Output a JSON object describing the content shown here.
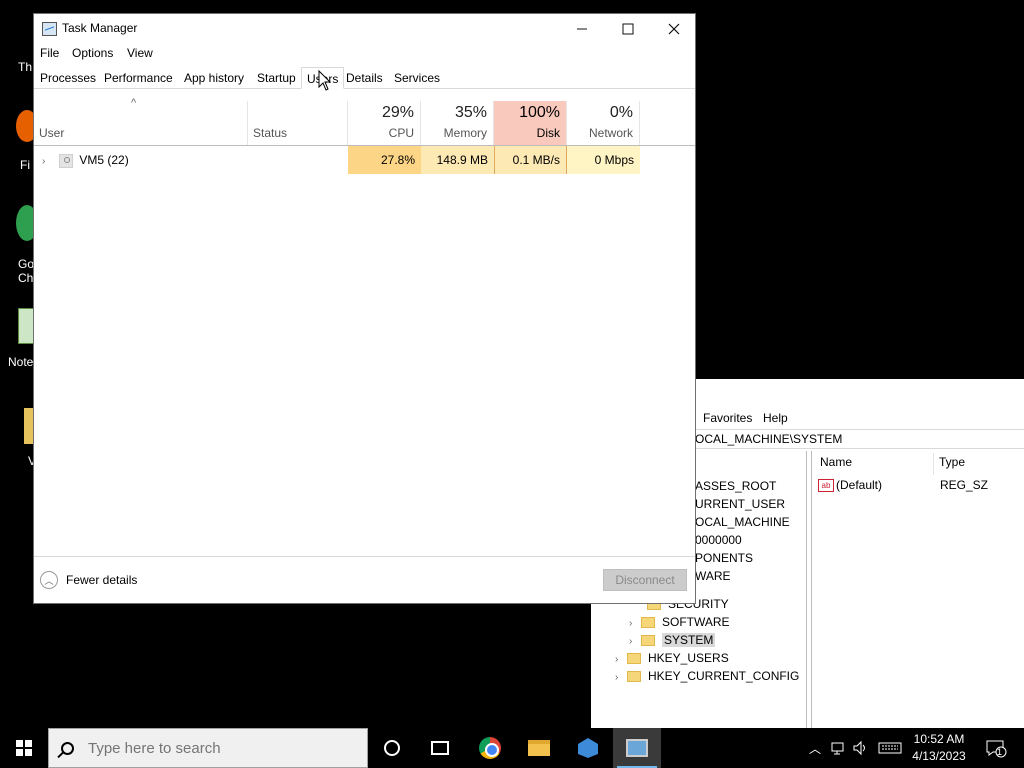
{
  "desktop": {
    "icons": [
      {
        "label": "Th"
      },
      {
        "label": "Fi"
      },
      {
        "label": "Go"
      },
      {
        "label": "Ch"
      },
      {
        "label": "Note"
      },
      {
        "label": "V"
      }
    ]
  },
  "regedit": {
    "menu": {
      "favorites": "Favorites",
      "help": "Help"
    },
    "address": "OCAL_MACHINE\\SYSTEM",
    "tree": [
      {
        "label": "ASSES_ROOT"
      },
      {
        "label": "URRENT_USER"
      },
      {
        "label": "OCAL_MACHINE"
      },
      {
        "label": "0000000"
      },
      {
        "label": "PONENTS"
      },
      {
        "label": "WARE"
      },
      {
        "label": "SECURITY"
      },
      {
        "label": "SOFTWARE"
      },
      {
        "label": "SYSTEM"
      },
      {
        "label": "HKEY_USERS"
      },
      {
        "label": "HKEY_CURRENT_CONFIG"
      }
    ],
    "list": {
      "headers": {
        "name": "Name",
        "type": "Type"
      },
      "rows": [
        {
          "name": "(Default)",
          "type": "REG_SZ",
          "icon": "ab"
        }
      ]
    }
  },
  "taskmanager": {
    "title": "Task Manager",
    "menu": {
      "file": "File",
      "options": "Options",
      "view": "View"
    },
    "tabs": [
      {
        "label": "Processes"
      },
      {
        "label": "Performance"
      },
      {
        "label": "App history"
      },
      {
        "label": "Startup"
      },
      {
        "label": "Users",
        "active": true
      },
      {
        "label": "Details"
      },
      {
        "label": "Services"
      }
    ],
    "columns": {
      "user": "User",
      "status": "Status",
      "cpu": {
        "pct": "29%",
        "name": "CPU"
      },
      "memory": {
        "pct": "35%",
        "name": "Memory"
      },
      "disk": {
        "pct": "100%",
        "name": "Disk"
      },
      "network": {
        "pct": "0%",
        "name": "Network"
      }
    },
    "rows": [
      {
        "user": "VM5 (22)",
        "status": "",
        "cpu": "27.8%",
        "memory": "148.9 MB",
        "disk": "0.1 MB/s",
        "network": "0 Mbps"
      }
    ],
    "footer": {
      "fewer_details": "Fewer details",
      "disconnect": "Disconnect"
    },
    "colors": {
      "cpu_cell": "#fcd686",
      "mem_cell": "#fde9b3",
      "disk_cell": "#fde9b3",
      "net_cell": "#fff4c4",
      "disk_header": "#f9c9bd"
    }
  },
  "taskbar": {
    "search_placeholder": "Type here to search",
    "clock": {
      "time": "10:52 AM",
      "date": "4/13/2023"
    },
    "notification_count": "1"
  }
}
